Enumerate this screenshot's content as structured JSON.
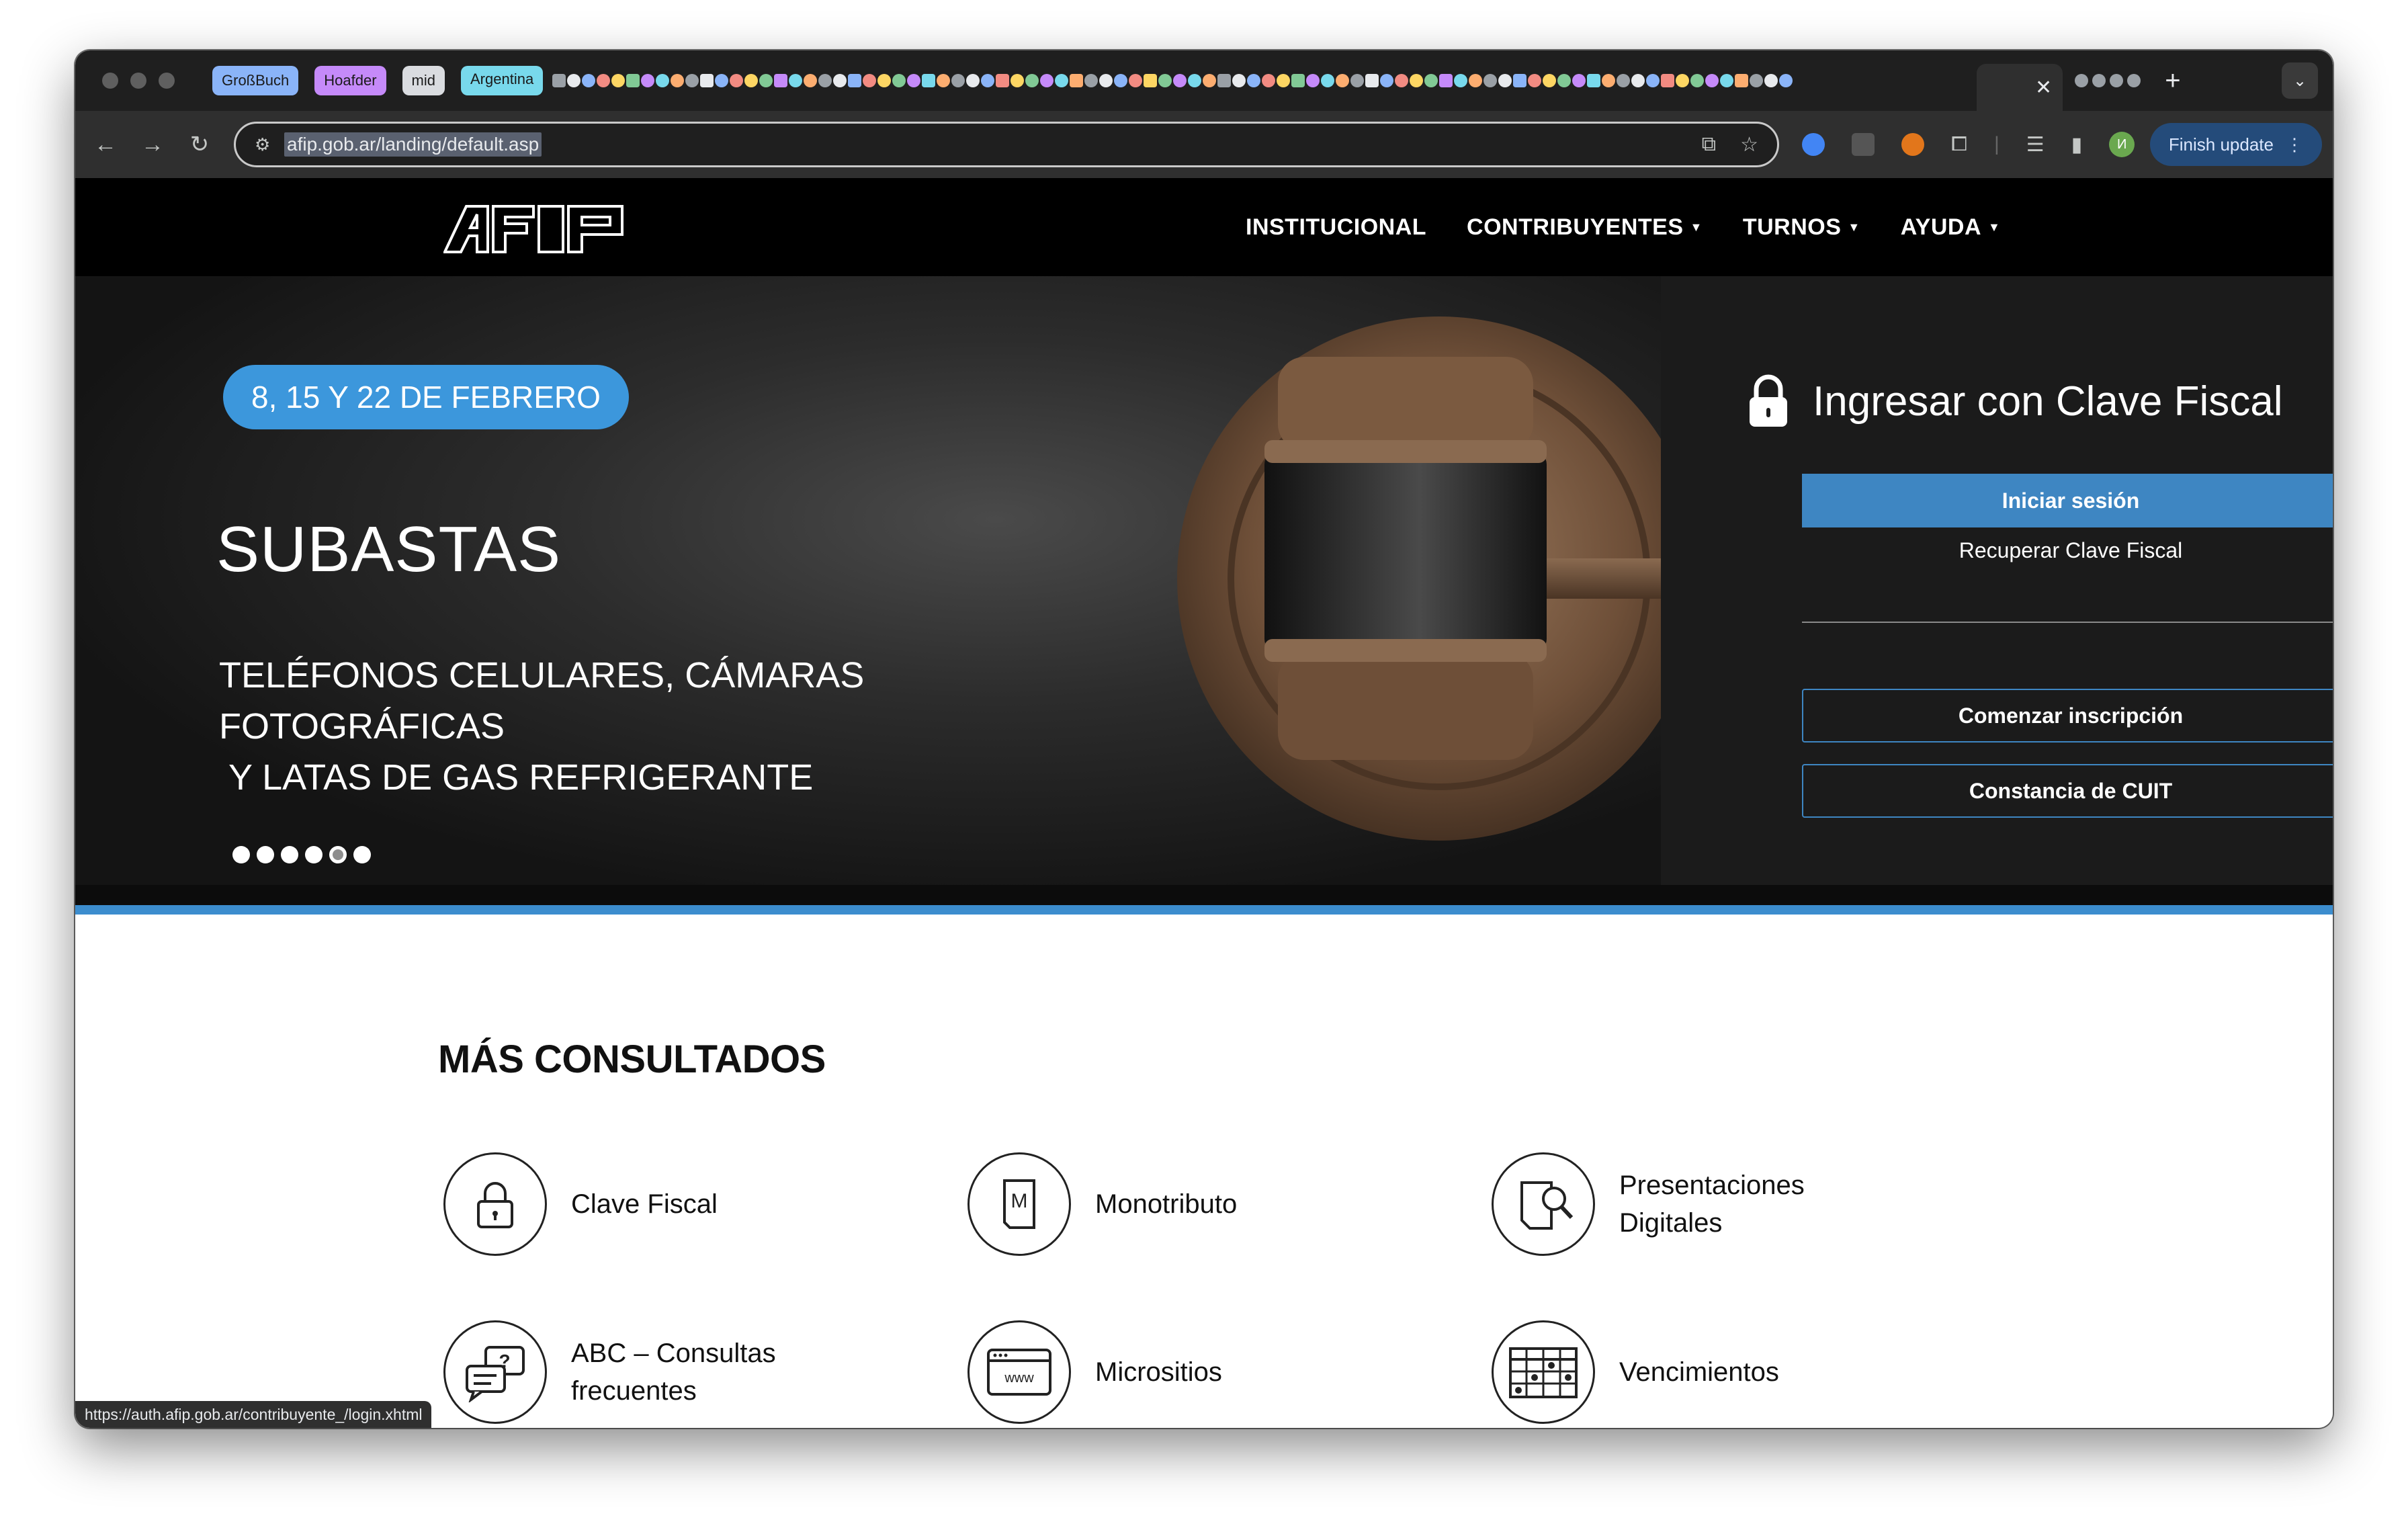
{
  "browser": {
    "tab_groups": [
      {
        "label": "GroßBuch",
        "color": "#8ab4f8"
      },
      {
        "label": "Hoafder",
        "color": "#c58af9"
      },
      {
        "label": "mid",
        "color": "#dadce0"
      },
      {
        "label": "Argentina",
        "color": "#78d9ec"
      }
    ],
    "close_tab_glyph": "✕",
    "new_tab_glyph": "+",
    "address_bar": {
      "url": "afip.gob.ar/landing/default.asp"
    },
    "finish_update_label": "Finish update",
    "profile_initial": "И",
    "status_url": "https://auth.afip.gob.ar/contribuyente_/login.xhtml"
  },
  "site": {
    "nav": {
      "items": [
        {
          "label": "INSTITUCIONAL",
          "has_dropdown": false
        },
        {
          "label": "CONTRIBUYENTES",
          "has_dropdown": true
        },
        {
          "label": "TURNOS",
          "has_dropdown": true
        },
        {
          "label": "AYUDA",
          "has_dropdown": true
        }
      ]
    },
    "hero": {
      "date_badge": "8, 15 Y 22 DE FEBRERO",
      "title": "SUBASTAS",
      "subtitle_line1": "TELÉFONOS CELULARES, CÁMARAS FOTOGRÁFICAS",
      "subtitle_line2": " Y LATAS DE GAS REFRIGERANTE",
      "slide_count": 6,
      "active_slide": 5
    },
    "login": {
      "title": "Ingresar con Clave Fiscal",
      "primary_button": "Iniciar sesión",
      "recover_link": "Recuperar Clave Fiscal",
      "signup_button": "Comenzar inscripción",
      "cuit_button": "Constancia de CUIT"
    },
    "most_consulted": {
      "title": "MÁS CONSULTADOS",
      "items": [
        {
          "label_line1": "Clave Fiscal",
          "label_line2": "",
          "icon": "padlock-icon"
        },
        {
          "label_line1": "Monotributo",
          "label_line2": "",
          "icon": "monotributo-m-icon",
          "icon_letter": "M"
        },
        {
          "label_line1": "Presentaciones",
          "label_line2": "Digitales",
          "icon": "document-search-icon"
        },
        {
          "label_line1": "ABC – Consultas",
          "label_line2": "frecuentes",
          "icon": "chat-question-icon",
          "icon_letter": "?"
        },
        {
          "label_line1": "Micrositios",
          "label_line2": "",
          "icon": "browser-www-icon",
          "icon_letter": "www"
        },
        {
          "label_line1": "Vencimientos",
          "label_line2": "",
          "icon": "calendar-icon"
        }
      ]
    }
  }
}
